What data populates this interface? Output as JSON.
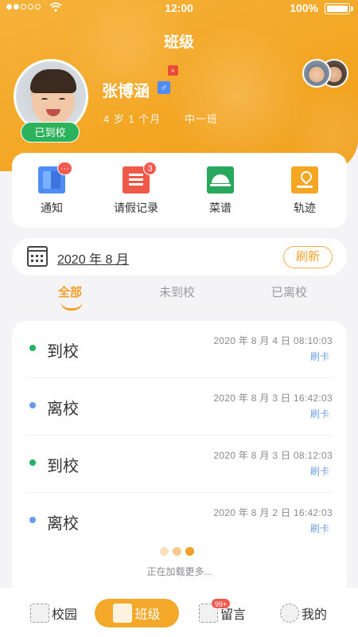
{
  "status_bar": {
    "time": "12:00",
    "battery": "100%"
  },
  "header": {
    "title": "班级",
    "student": {
      "name": "张博涵",
      "gender_symbol": "♂",
      "age": "4 岁 1 个月",
      "class_name": "中一班",
      "attendance_badge": "已到校"
    }
  },
  "quick_actions": [
    {
      "label": "通知",
      "icon": "notice-icon",
      "badge": "···"
    },
    {
      "label": "请假记录",
      "icon": "leave-record-icon",
      "badge": "3"
    },
    {
      "label": "菜谱",
      "icon": "menu-icon",
      "badge": ""
    },
    {
      "label": "轨迹",
      "icon": "track-icon",
      "badge": ""
    }
  ],
  "date_bar": {
    "date": "2020 年 8 月",
    "refresh_label": "刷新"
  },
  "tabs": [
    {
      "label": "全部"
    },
    {
      "label": "未到校"
    },
    {
      "label": "已离校"
    }
  ],
  "records": [
    {
      "type": "到校",
      "time": "2020 年 8 月 4 日   08:10:03",
      "method": "刷卡",
      "status": "arrive"
    },
    {
      "type": "离校",
      "time": "2020 年 8 月 3 日   16:42:03",
      "method": "刷卡",
      "status": "leave"
    },
    {
      "type": "到校",
      "time": "2020 年 8 月 3 日   08:12:03",
      "method": "刷卡",
      "status": "arrive"
    },
    {
      "type": "离校",
      "time": "2020 年 8 月 2 日   16:42:03",
      "method": "刷卡",
      "status": "leave"
    }
  ],
  "loading_text": "正在加载更多...",
  "bottom_nav": [
    {
      "label": "校园",
      "icon": "campus-icon"
    },
    {
      "label": "班级",
      "icon": "class-icon"
    },
    {
      "label": "留言",
      "icon": "message-icon",
      "badge": "99+"
    },
    {
      "label": "我的",
      "icon": "profile-icon"
    }
  ],
  "colors": {
    "accent": "#f3a028",
    "arrive": "#23b35f",
    "leave": "#6b98e8",
    "refresh": "#f3a028"
  }
}
